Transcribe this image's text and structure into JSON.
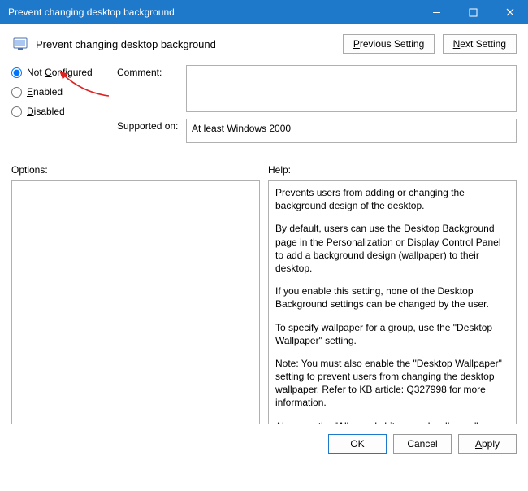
{
  "window": {
    "title": "Prevent changing desktop background"
  },
  "header": {
    "policy_title": "Prevent changing desktop background",
    "nav": {
      "previous": "Previous Setting",
      "next": "Next Setting"
    }
  },
  "state": {
    "options": [
      {
        "label": "Not Configured",
        "hotkey_index": 4,
        "checked": true
      },
      {
        "label": "Enabled",
        "hotkey_index": 0,
        "checked": false
      },
      {
        "label": "Disabled",
        "hotkey_index": 0,
        "checked": false
      }
    ]
  },
  "fields": {
    "comment_label": "Comment:",
    "comment_value": "",
    "supported_label": "Supported on:",
    "supported_value": "At least Windows 2000"
  },
  "panels": {
    "options_label": "Options:",
    "help_label": "Help:",
    "help_paragraphs": [
      "Prevents users from adding or changing the background design of the desktop.",
      "By default, users can use the Desktop Background page in the Personalization or Display Control Panel to add a background design (wallpaper) to their desktop.",
      "If you enable this setting, none of the Desktop Background settings can be changed by the user.",
      "To specify wallpaper for a group, use the \"Desktop Wallpaper\" setting.",
      "Note: You must also enable the \"Desktop Wallpaper\" setting to prevent users from changing the desktop wallpaper. Refer to KB article: Q327998 for more information.",
      "Also, see the \"Allow only bitmapped wallpaper\" setting."
    ]
  },
  "footer": {
    "ok": "OK",
    "cancel": "Cancel",
    "apply": "Apply"
  }
}
